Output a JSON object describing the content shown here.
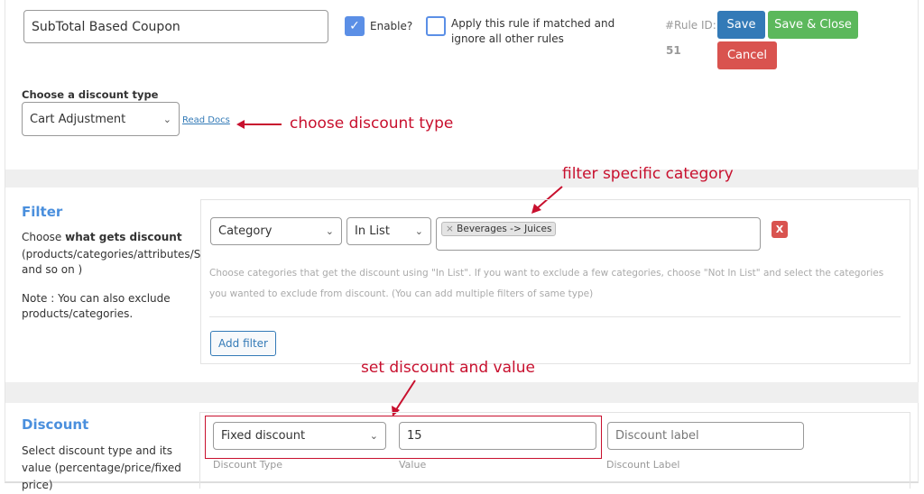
{
  "rule": {
    "name_value": "SubTotal Based Coupon",
    "enable_label": "Enable?",
    "enable_checked": true,
    "exclusive_label": "Apply this rule if matched and ignore all other rules",
    "exclusive_checked": false,
    "rule_id_label": "#Rule ID:",
    "rule_id": "51",
    "save_label": "Save",
    "save_close_label": "Save & Close",
    "cancel_label": "Cancel"
  },
  "discount_type": {
    "label": "Choose a discount type",
    "selected": "Cart Adjustment",
    "read_docs": "Read Docs"
  },
  "filter": {
    "heading": "Filter",
    "desc_prefix": "Choose ",
    "desc_bold": "what gets discount",
    "desc_rest": "(products/categories/attributes/SKU and so on )",
    "note": "Note : You can also exclude products/categories.",
    "type_selected": "Category",
    "operator_selected": "In List",
    "tag": "Beverages -> Juices",
    "tag_remove": "×",
    "remove_label": "X",
    "help": "Choose categories that get the discount using \"In List\". If you want to exclude a few categories, choose \"Not In List\" and select the categories you wanted to exclude from discount. (You can add multiple filters of same type)",
    "add_filter": "Add filter"
  },
  "discount": {
    "heading": "Discount",
    "desc": "Select discount type and its value (percentage/price/fixed price)",
    "type_selected": "Fixed discount",
    "value": "15",
    "label_placeholder": "Discount label",
    "type_caption": "Discount Type",
    "value_caption": "Value",
    "label_caption": "Discount Label"
  },
  "annotations": {
    "a1": "choose discount type",
    "a2": "filter specific category",
    "a3": "set discount and value"
  },
  "colors": {
    "primary": "#337ab7",
    "success": "#5cb85c",
    "danger": "#d9534f",
    "annotation": "#c8102e",
    "heading": "#4a8fdd"
  }
}
